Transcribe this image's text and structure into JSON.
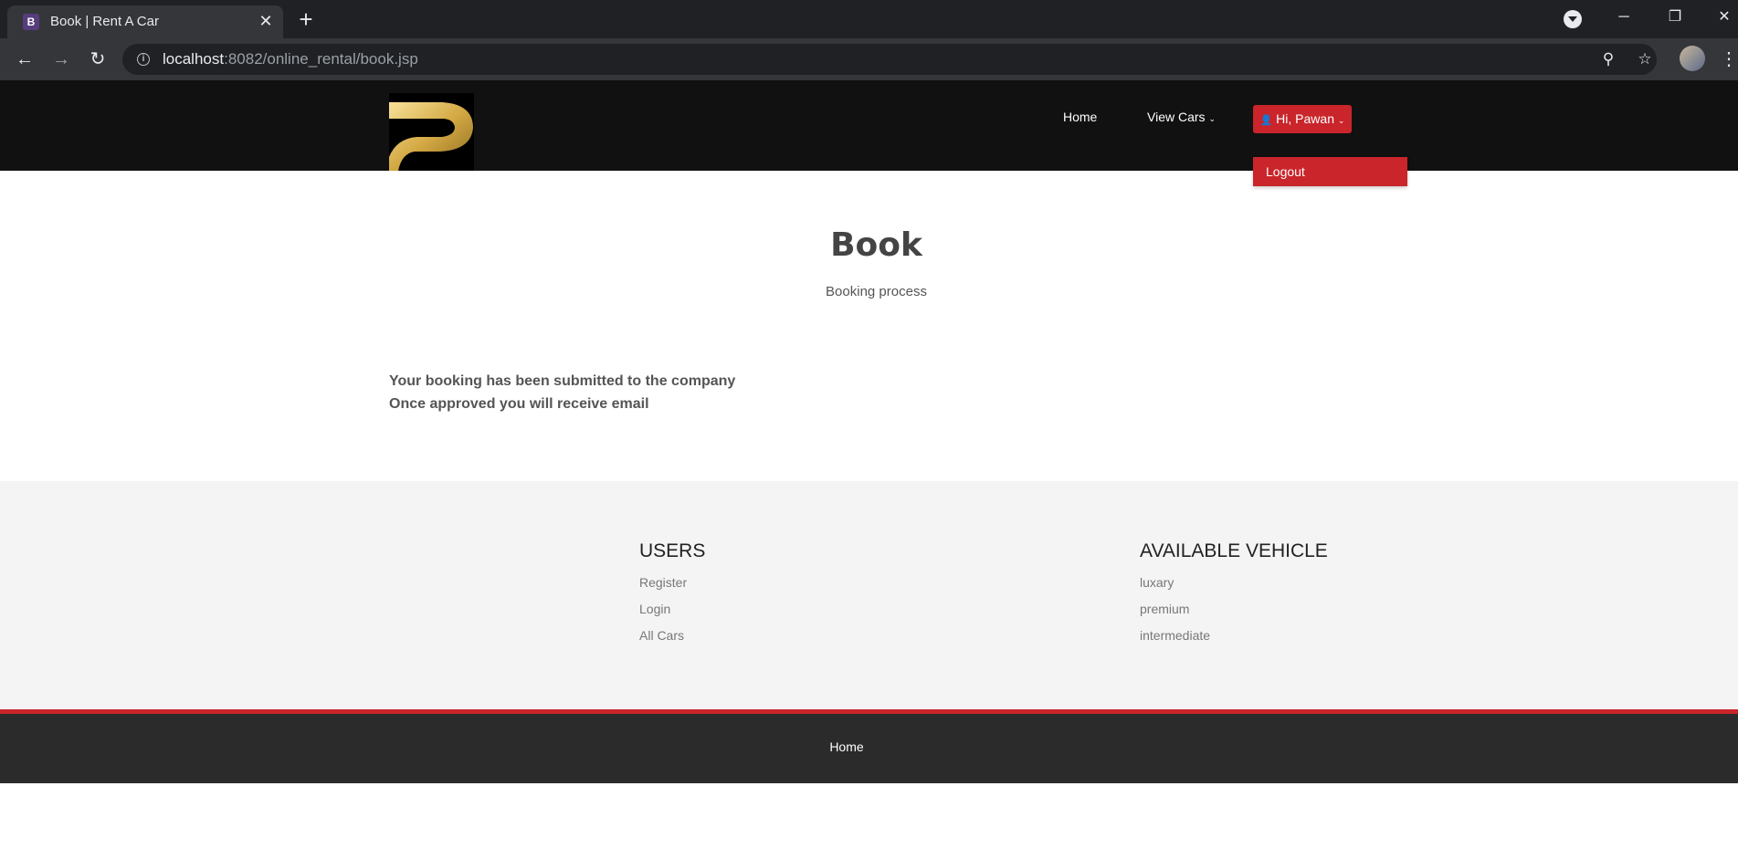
{
  "browser": {
    "tab_favicon": "B",
    "tab_title": "Book | Rent A Car",
    "url_host": "localhost",
    "url_path": ":8082/online_rental/book.jsp",
    "icons": [
      "close-icon",
      "plus-icon",
      "back-icon",
      "forward-icon",
      "reload-icon",
      "info-icon",
      "zoom-icon",
      "star-icon",
      "kebab-menu-icon"
    ]
  },
  "header": {
    "nav_home": "Home",
    "nav_view_cars": "View Cars",
    "user_button": "Hi, Pawan",
    "dropdown_logout": "Logout",
    "accent_color": "#c9252b"
  },
  "main": {
    "title": "Book",
    "subtitle": "Booking process",
    "message_line1": "Your booking has been submitted to the company",
    "message_line2": "Once approved you will receive email"
  },
  "footer": {
    "users_heading": "USERS",
    "users_links": [
      "Register",
      "Login",
      "All Cars"
    ],
    "vehicle_heading": "AVAILABLE VEHICLE",
    "vehicle_links": [
      "luxary",
      "premium",
      "intermediate"
    ],
    "bottom_home": "Home"
  }
}
